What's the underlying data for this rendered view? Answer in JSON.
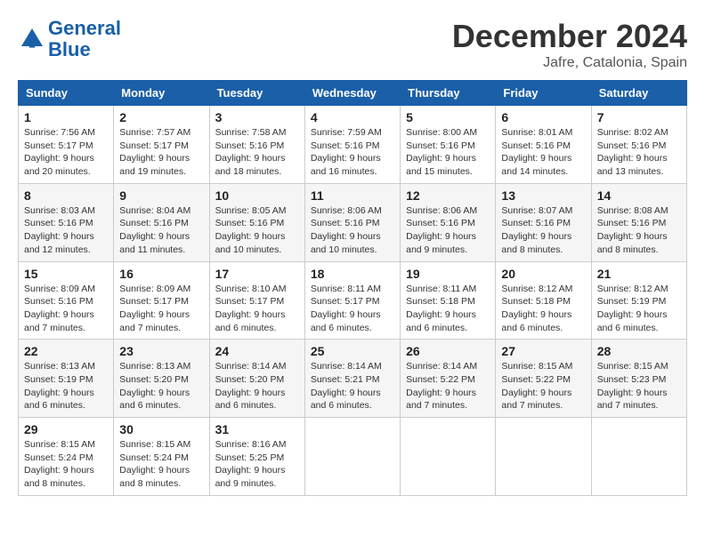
{
  "header": {
    "logo_line1": "General",
    "logo_line2": "Blue",
    "month_title": "December 2024",
    "location": "Jafre, Catalonia, Spain"
  },
  "weekdays": [
    "Sunday",
    "Monday",
    "Tuesday",
    "Wednesday",
    "Thursday",
    "Friday",
    "Saturday"
  ],
  "weeks": [
    [
      {
        "day": "1",
        "sunrise": "7:56 AM",
        "sunset": "5:17 PM",
        "daylight": "9 hours and 20 minutes."
      },
      {
        "day": "2",
        "sunrise": "7:57 AM",
        "sunset": "5:17 PM",
        "daylight": "9 hours and 19 minutes."
      },
      {
        "day": "3",
        "sunrise": "7:58 AM",
        "sunset": "5:16 PM",
        "daylight": "9 hours and 18 minutes."
      },
      {
        "day": "4",
        "sunrise": "7:59 AM",
        "sunset": "5:16 PM",
        "daylight": "9 hours and 16 minutes."
      },
      {
        "day": "5",
        "sunrise": "8:00 AM",
        "sunset": "5:16 PM",
        "daylight": "9 hours and 15 minutes."
      },
      {
        "day": "6",
        "sunrise": "8:01 AM",
        "sunset": "5:16 PM",
        "daylight": "9 hours and 14 minutes."
      },
      {
        "day": "7",
        "sunrise": "8:02 AM",
        "sunset": "5:16 PM",
        "daylight": "9 hours and 13 minutes."
      }
    ],
    [
      {
        "day": "8",
        "sunrise": "8:03 AM",
        "sunset": "5:16 PM",
        "daylight": "9 hours and 12 minutes."
      },
      {
        "day": "9",
        "sunrise": "8:04 AM",
        "sunset": "5:16 PM",
        "daylight": "9 hours and 11 minutes."
      },
      {
        "day": "10",
        "sunrise": "8:05 AM",
        "sunset": "5:16 PM",
        "daylight": "9 hours and 10 minutes."
      },
      {
        "day": "11",
        "sunrise": "8:06 AM",
        "sunset": "5:16 PM",
        "daylight": "9 hours and 10 minutes."
      },
      {
        "day": "12",
        "sunrise": "8:06 AM",
        "sunset": "5:16 PM",
        "daylight": "9 hours and 9 minutes."
      },
      {
        "day": "13",
        "sunrise": "8:07 AM",
        "sunset": "5:16 PM",
        "daylight": "9 hours and 8 minutes."
      },
      {
        "day": "14",
        "sunrise": "8:08 AM",
        "sunset": "5:16 PM",
        "daylight": "9 hours and 8 minutes."
      }
    ],
    [
      {
        "day": "15",
        "sunrise": "8:09 AM",
        "sunset": "5:16 PM",
        "daylight": "9 hours and 7 minutes."
      },
      {
        "day": "16",
        "sunrise": "8:09 AM",
        "sunset": "5:17 PM",
        "daylight": "9 hours and 7 minutes."
      },
      {
        "day": "17",
        "sunrise": "8:10 AM",
        "sunset": "5:17 PM",
        "daylight": "9 hours and 6 minutes."
      },
      {
        "day": "18",
        "sunrise": "8:11 AM",
        "sunset": "5:17 PM",
        "daylight": "9 hours and 6 minutes."
      },
      {
        "day": "19",
        "sunrise": "8:11 AM",
        "sunset": "5:18 PM",
        "daylight": "9 hours and 6 minutes."
      },
      {
        "day": "20",
        "sunrise": "8:12 AM",
        "sunset": "5:18 PM",
        "daylight": "9 hours and 6 minutes."
      },
      {
        "day": "21",
        "sunrise": "8:12 AM",
        "sunset": "5:19 PM",
        "daylight": "9 hours and 6 minutes."
      }
    ],
    [
      {
        "day": "22",
        "sunrise": "8:13 AM",
        "sunset": "5:19 PM",
        "daylight": "9 hours and 6 minutes."
      },
      {
        "day": "23",
        "sunrise": "8:13 AM",
        "sunset": "5:20 PM",
        "daylight": "9 hours and 6 minutes."
      },
      {
        "day": "24",
        "sunrise": "8:14 AM",
        "sunset": "5:20 PM",
        "daylight": "9 hours and 6 minutes."
      },
      {
        "day": "25",
        "sunrise": "8:14 AM",
        "sunset": "5:21 PM",
        "daylight": "9 hours and 6 minutes."
      },
      {
        "day": "26",
        "sunrise": "8:14 AM",
        "sunset": "5:22 PM",
        "daylight": "9 hours and 7 minutes."
      },
      {
        "day": "27",
        "sunrise": "8:15 AM",
        "sunset": "5:22 PM",
        "daylight": "9 hours and 7 minutes."
      },
      {
        "day": "28",
        "sunrise": "8:15 AM",
        "sunset": "5:23 PM",
        "daylight": "9 hours and 7 minutes."
      }
    ],
    [
      {
        "day": "29",
        "sunrise": "8:15 AM",
        "sunset": "5:24 PM",
        "daylight": "9 hours and 8 minutes."
      },
      {
        "day": "30",
        "sunrise": "8:15 AM",
        "sunset": "5:24 PM",
        "daylight": "9 hours and 8 minutes."
      },
      {
        "day": "31",
        "sunrise": "8:16 AM",
        "sunset": "5:25 PM",
        "daylight": "9 hours and 9 minutes."
      },
      null,
      null,
      null,
      null
    ]
  ]
}
